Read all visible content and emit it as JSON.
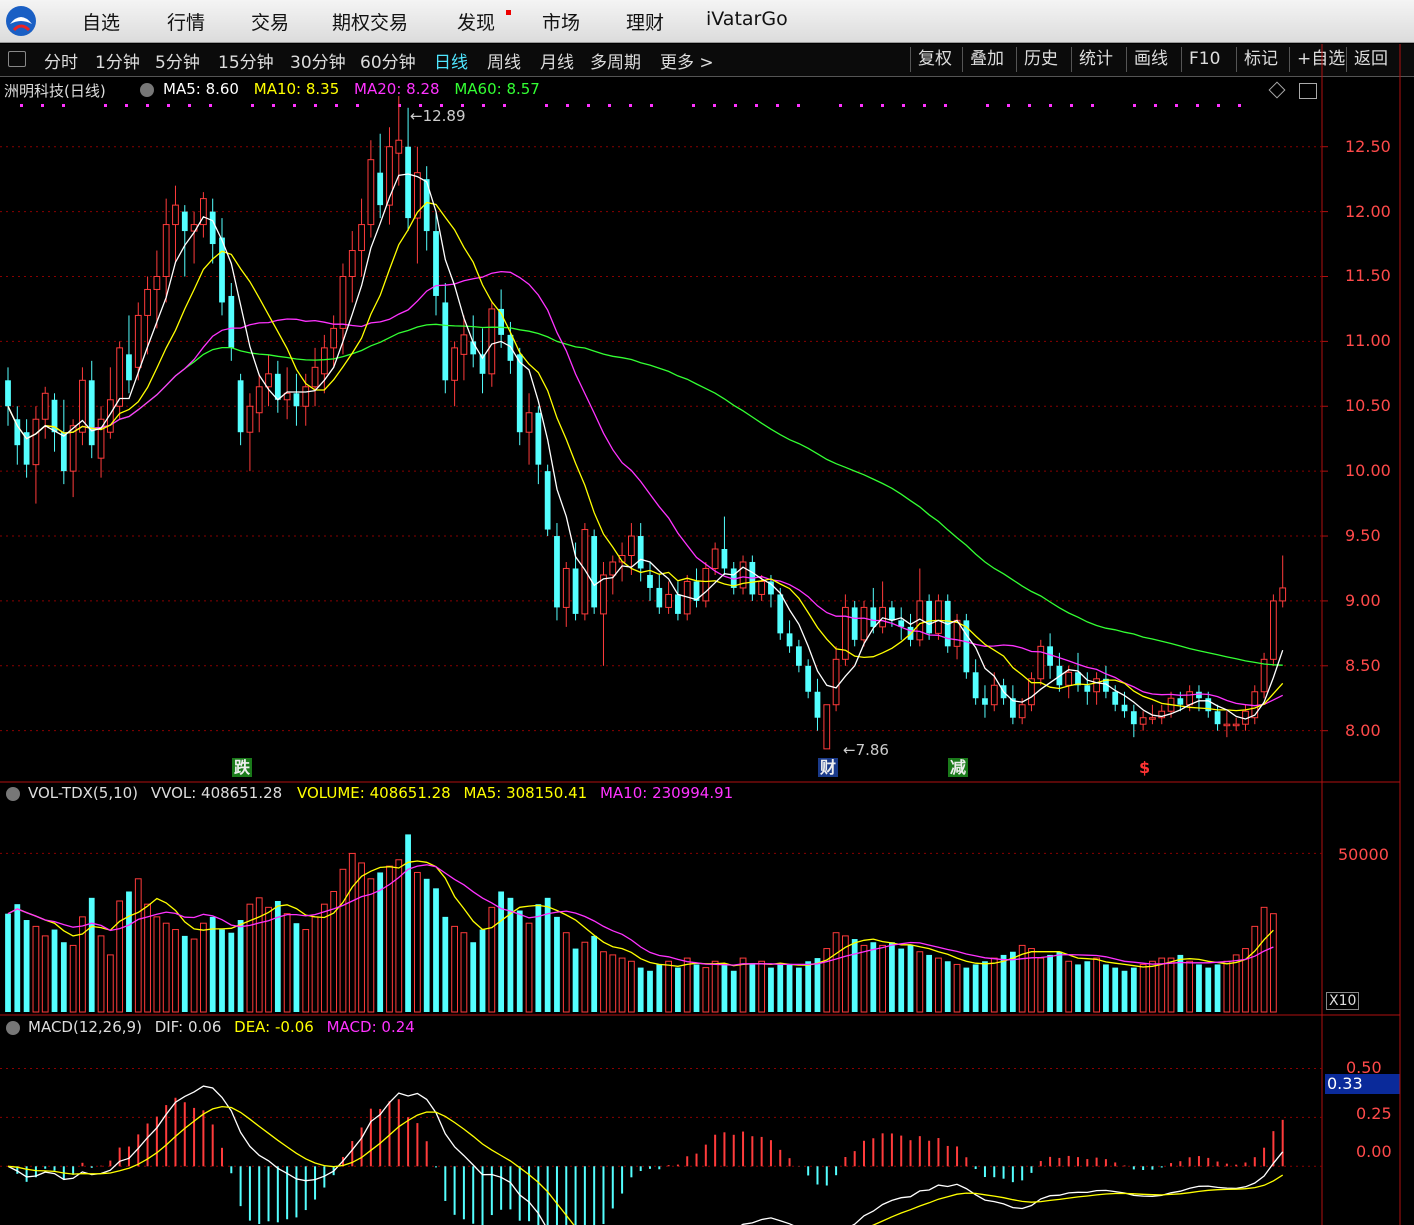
{
  "topbar": {
    "menu": [
      "自选",
      "行情",
      "交易",
      "期权交易",
      "发现",
      "市场",
      "理财",
      "iVatarGo"
    ]
  },
  "toolbar": {
    "periods": [
      "分时",
      "1分钟",
      "5分钟",
      "15分钟",
      "30分钟",
      "60分钟",
      "日线",
      "周线",
      "月线",
      "多周期",
      "更多 >"
    ],
    "active_period": "日线",
    "right_buttons": [
      "复权",
      "叠加",
      "历史",
      "统计",
      "画线",
      "F10",
      "标记",
      "+自选",
      "返回"
    ]
  },
  "main_panel": {
    "stock_title": "洲明科技(日线)",
    "ma5": "MA5: 8.60",
    "ma10": "MA10: 8.35",
    "ma20": "MA20: 8.28",
    "ma60": "MA60: 8.57",
    "high_marker": "12.89",
    "low_marker": "7.86",
    "signals": [
      "跌",
      "财",
      "减",
      "$"
    ]
  },
  "volume_panel": {
    "title": "VOL-TDX(5,10)",
    "vvol": "VVOL: 408651.28",
    "volume": "VOLUME: 408651.28",
    "ma5": "MA5: 308150.41",
    "ma10": "MA10: 230994.91",
    "unit": "X10",
    "tick": "50000"
  },
  "macd_panel": {
    "title": "MACD(12,26,9)",
    "dif": "DIF: 0.06",
    "dea": "DEA: -0.06",
    "macd": "MACD: 0.24",
    "current": "0.33",
    "ticks": [
      "0.50",
      "0.25",
      "0.00"
    ]
  },
  "colors": {
    "up": "#ff3b3b",
    "down": "#54ffff",
    "ma5": "#ffffff",
    "ma10": "#ffff00",
    "ma20": "#ff33ff",
    "ma60": "#33ff33"
  },
  "chart_data": {
    "type": "candlestick",
    "y_ticks": [
      8.0,
      8.5,
      9.0,
      9.5,
      10.0,
      10.5,
      11.0,
      11.5,
      12.0,
      12.5
    ],
    "ylim": [
      7.62,
      12.86
    ],
    "candles": [
      [
        10.7,
        10.8,
        10.35,
        10.5
      ],
      [
        10.4,
        10.5,
        10.05,
        10.2
      ],
      [
        10.3,
        10.4,
        9.95,
        10.05
      ],
      [
        10.05,
        10.5,
        9.75,
        10.4
      ],
      [
        10.4,
        10.65,
        10.25,
        10.6
      ],
      [
        10.55,
        10.6,
        10.15,
        10.3
      ],
      [
        10.3,
        10.55,
        9.9,
        10.0
      ],
      [
        10.0,
        10.4,
        9.8,
        10.35
      ],
      [
        10.3,
        10.8,
        10.2,
        10.7
      ],
      [
        10.7,
        10.85,
        10.1,
        10.2
      ],
      [
        10.1,
        10.5,
        9.95,
        10.4
      ],
      [
        10.3,
        10.8,
        10.25,
        10.55
      ],
      [
        10.5,
        11.0,
        10.4,
        10.95
      ],
      [
        10.9,
        11.2,
        10.6,
        10.7
      ],
      [
        10.8,
        11.3,
        10.7,
        11.2
      ],
      [
        11.2,
        11.5,
        10.9,
        11.4
      ],
      [
        11.4,
        11.7,
        11.1,
        11.5
      ],
      [
        11.5,
        12.1,
        11.3,
        11.9
      ],
      [
        11.9,
        12.2,
        11.6,
        12.05
      ],
      [
        12.0,
        12.05,
        11.5,
        11.85
      ],
      [
        11.85,
        12.0,
        11.6,
        11.9
      ],
      [
        11.9,
        12.15,
        11.8,
        12.1
      ],
      [
        12.0,
        12.1,
        11.6,
        11.75
      ],
      [
        11.8,
        11.95,
        11.2,
        11.3
      ],
      [
        11.35,
        11.45,
        10.85,
        10.95
      ],
      [
        10.7,
        10.75,
        10.2,
        10.3
      ],
      [
        10.3,
        10.6,
        10.0,
        10.5
      ],
      [
        10.45,
        10.75,
        10.3,
        10.65
      ],
      [
        10.65,
        10.9,
        10.5,
        10.75
      ],
      [
        10.75,
        10.85,
        10.45,
        10.55
      ],
      [
        10.55,
        10.8,
        10.4,
        10.6
      ],
      [
        10.6,
        10.75,
        10.35,
        10.5
      ],
      [
        10.5,
        10.75,
        10.35,
        10.65
      ],
      [
        10.65,
        10.95,
        10.5,
        10.8
      ],
      [
        10.75,
        11.05,
        10.6,
        10.95
      ],
      [
        10.95,
        11.2,
        10.8,
        11.1
      ],
      [
        11.1,
        11.6,
        10.9,
        11.5
      ],
      [
        11.5,
        11.85,
        11.3,
        11.7
      ],
      [
        11.7,
        12.1,
        11.5,
        11.9
      ],
      [
        11.9,
        12.55,
        11.8,
        12.4
      ],
      [
        12.3,
        12.6,
        11.95,
        12.05
      ],
      [
        12.05,
        12.65,
        11.9,
        12.5
      ],
      [
        12.45,
        12.89,
        12.2,
        12.55
      ],
      [
        12.5,
        12.8,
        11.85,
        11.95
      ],
      [
        11.95,
        12.5,
        11.6,
        12.3
      ],
      [
        12.25,
        12.35,
        11.7,
        11.85
      ],
      [
        11.85,
        12.0,
        11.2,
        11.35
      ],
      [
        11.3,
        11.45,
        10.6,
        10.7
      ],
      [
        10.7,
        11.0,
        10.5,
        10.95
      ],
      [
        10.9,
        11.2,
        10.7,
        11.05
      ],
      [
        11.0,
        11.2,
        10.8,
        10.9
      ],
      [
        10.9,
        11.1,
        10.6,
        10.75
      ],
      [
        10.75,
        11.3,
        10.65,
        11.25
      ],
      [
        11.25,
        11.4,
        10.95,
        11.05
      ],
      [
        11.05,
        11.15,
        10.75,
        10.85
      ],
      [
        10.9,
        10.95,
        10.2,
        10.3
      ],
      [
        10.3,
        10.6,
        10.05,
        10.45
      ],
      [
        10.45,
        10.5,
        9.9,
        10.05
      ],
      [
        10.0,
        10.05,
        9.5,
        9.55
      ],
      [
        9.5,
        9.6,
        8.85,
        8.95
      ],
      [
        8.95,
        9.3,
        8.8,
        9.25
      ],
      [
        9.25,
        9.45,
        8.85,
        8.9
      ],
      [
        8.9,
        9.6,
        8.85,
        9.55
      ],
      [
        9.5,
        9.55,
        8.9,
        8.95
      ],
      [
        8.9,
        9.3,
        8.5,
        9.2
      ],
      [
        9.2,
        9.35,
        9.05,
        9.3
      ],
      [
        9.3,
        9.45,
        9.15,
        9.35
      ],
      [
        9.35,
        9.6,
        9.2,
        9.5
      ],
      [
        9.5,
        9.6,
        9.15,
        9.25
      ],
      [
        9.2,
        9.3,
        9.0,
        9.1
      ],
      [
        9.1,
        9.2,
        8.9,
        8.95
      ],
      [
        8.95,
        9.15,
        8.9,
        9.05
      ],
      [
        9.05,
        9.15,
        8.85,
        8.9
      ],
      [
        8.9,
        9.2,
        8.85,
        9.15
      ],
      [
        9.15,
        9.25,
        8.95,
        9.0
      ],
      [
        9.0,
        9.3,
        8.95,
        9.25
      ],
      [
        9.25,
        9.45,
        9.2,
        9.4
      ],
      [
        9.4,
        9.65,
        9.2,
        9.25
      ],
      [
        9.25,
        9.3,
        9.05,
        9.1
      ],
      [
        9.1,
        9.35,
        9.05,
        9.3
      ],
      [
        9.3,
        9.35,
        9.0,
        9.05
      ],
      [
        9.05,
        9.2,
        9.0,
        9.15
      ],
      [
        9.15,
        9.2,
        8.95,
        9.05
      ],
      [
        9.05,
        9.1,
        8.7,
        8.75
      ],
      [
        8.75,
        8.85,
        8.6,
        8.65
      ],
      [
        8.65,
        8.7,
        8.45,
        8.5
      ],
      [
        8.5,
        8.55,
        8.25,
        8.3
      ],
      [
        8.3,
        8.4,
        8.0,
        8.1
      ],
      [
        7.86,
        8.2,
        7.86,
        8.2
      ],
      [
        8.2,
        8.65,
        8.15,
        8.55
      ],
      [
        8.55,
        9.05,
        8.5,
        8.95
      ],
      [
        8.95,
        9.0,
        8.65,
        8.7
      ],
      [
        8.7,
        9.0,
        8.65,
        8.95
      ],
      [
        8.95,
        9.1,
        8.75,
        8.8
      ],
      [
        8.8,
        9.15,
        8.75,
        8.95
      ],
      [
        8.95,
        9.0,
        8.8,
        8.85
      ],
      [
        8.85,
        8.95,
        8.7,
        8.8
      ],
      [
        8.8,
        8.9,
        8.65,
        8.7
      ],
      [
        8.7,
        9.25,
        8.65,
        9.0
      ],
      [
        9.0,
        9.05,
        8.7,
        8.75
      ],
      [
        8.75,
        9.05,
        8.7,
        9.0
      ],
      [
        9.0,
        9.05,
        8.6,
        8.65
      ],
      [
        8.65,
        8.9,
        8.55,
        8.85
      ],
      [
        8.85,
        8.9,
        8.4,
        8.45
      ],
      [
        8.45,
        8.55,
        8.2,
        8.25
      ],
      [
        8.25,
        8.35,
        8.1,
        8.2
      ],
      [
        8.2,
        8.45,
        8.15,
        8.35
      ],
      [
        8.35,
        8.4,
        8.2,
        8.25
      ],
      [
        8.25,
        8.35,
        8.05,
        8.1
      ],
      [
        8.1,
        8.25,
        8.05,
        8.2
      ],
      [
        8.2,
        8.45,
        8.15,
        8.4
      ],
      [
        8.4,
        8.7,
        8.35,
        8.65
      ],
      [
        8.65,
        8.75,
        8.4,
        8.5
      ],
      [
        8.5,
        8.6,
        8.3,
        8.35
      ],
      [
        8.35,
        8.5,
        8.25,
        8.45
      ],
      [
        8.45,
        8.6,
        8.3,
        8.35
      ],
      [
        8.35,
        8.45,
        8.2,
        8.3
      ],
      [
        8.3,
        8.45,
        8.2,
        8.4
      ],
      [
        8.4,
        8.5,
        8.25,
        8.3
      ],
      [
        8.3,
        8.35,
        8.15,
        8.2
      ],
      [
        8.2,
        8.3,
        8.1,
        8.15
      ],
      [
        8.15,
        8.2,
        7.95,
        8.05
      ],
      [
        8.05,
        8.15,
        8.0,
        8.1
      ],
      [
        8.1,
        8.2,
        8.05,
        8.1
      ],
      [
        8.1,
        8.2,
        8.05,
        8.15
      ],
      [
        8.15,
        8.3,
        8.1,
        8.25
      ],
      [
        8.25,
        8.3,
        8.15,
        8.2
      ],
      [
        8.2,
        8.35,
        8.15,
        8.3
      ],
      [
        8.3,
        8.35,
        8.15,
        8.25
      ],
      [
        8.25,
        8.3,
        8.1,
        8.15
      ],
      [
        8.15,
        8.2,
        8.0,
        8.05
      ],
      [
        8.05,
        8.15,
        7.95,
        8.05
      ],
      [
        8.05,
        8.1,
        8.0,
        8.05
      ],
      [
        8.05,
        8.2,
        8.0,
        8.15
      ],
      [
        8.1,
        8.35,
        8.05,
        8.3
      ],
      [
        8.3,
        8.6,
        8.25,
        8.55
      ],
      [
        8.55,
        9.05,
        8.5,
        9.0
      ],
      [
        9.0,
        9.35,
        8.95,
        9.1
      ]
    ],
    "volume": [
      31000,
      34000,
      29000,
      27000,
      24000,
      26000,
      22000,
      21000,
      30000,
      36000,
      24000,
      18000,
      35000,
      38000,
      42000,
      34000,
      30000,
      28000,
      26000,
      24000,
      23000,
      28000,
      30000,
      26000,
      25000,
      29000,
      34000,
      36000,
      33000,
      35000,
      31000,
      28000,
      26000,
      30000,
      34000,
      38000,
      45000,
      50000,
      47000,
      42000,
      44000,
      46000,
      48000,
      56000,
      44000,
      42000,
      39000,
      30000,
      27000,
      25000,
      22000,
      26000,
      33000,
      38000,
      36000,
      32000,
      28000,
      34000,
      36000,
      30000,
      25000,
      20000,
      22000,
      24000,
      19000,
      18000,
      17000,
      16000,
      14000,
      13000,
      15000,
      16000,
      14000,
      17000,
      15000,
      14000,
      16000,
      15000,
      13000,
      17000,
      15000,
      16000,
      14000,
      15000,
      15000,
      14000,
      16000,
      17000,
      20000,
      25000,
      24000,
      23000,
      21000,
      22000,
      21000,
      22000,
      20000,
      21000,
      19000,
      18000,
      17000,
      16000,
      15000,
      14000,
      15000,
      16000,
      17000,
      18000,
      19000,
      21000,
      20000,
      17000,
      18000,
      19000,
      16000,
      15000,
      16000,
      17000,
      15000,
      14000,
      13000,
      14000,
      15000,
      16000,
      17000,
      17000,
      18000,
      16000,
      15000,
      14000,
      15000,
      16000,
      18000,
      20000,
      27000,
      33000,
      31000
    ],
    "vol_ylim": [
      0,
      70000
    ],
    "macd_ylim": [
      -0.3,
      0.62
    ]
  }
}
